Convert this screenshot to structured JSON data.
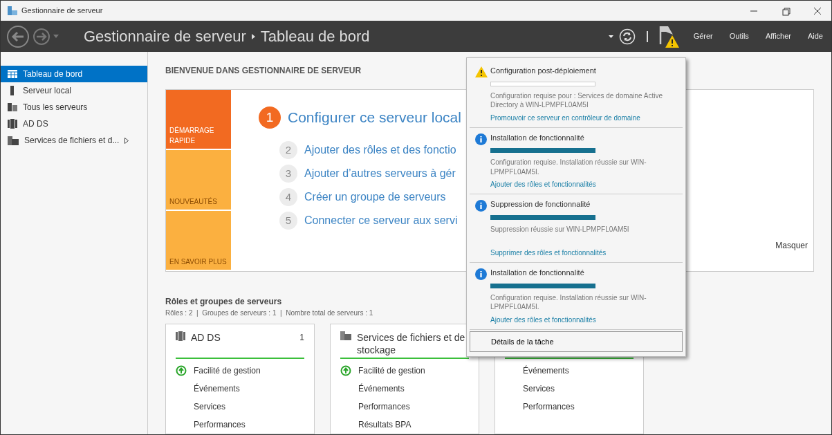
{
  "window": {
    "title": "Gestionnaire de serveur"
  },
  "header": {
    "breadcrumb": [
      "Gestionnaire de serveur",
      "Tableau de bord"
    ],
    "menu": [
      "Gérer",
      "Outils",
      "Afficher",
      "Aide"
    ]
  },
  "sidebar": {
    "items": [
      {
        "label": "Tableau de bord",
        "selected": true,
        "expandable": false
      },
      {
        "label": "Serveur local",
        "selected": false,
        "expandable": false
      },
      {
        "label": "Tous les serveurs",
        "selected": false,
        "expandable": false
      },
      {
        "label": "AD DS",
        "selected": false,
        "expandable": false
      },
      {
        "label": "Services de fichiers et d...",
        "selected": false,
        "expandable": true
      }
    ]
  },
  "welcome": {
    "title": "BIENVENUE DANS GESTIONNAIRE DE SERVEUR",
    "tiles": [
      {
        "label": "DÉMARRAGE RAPIDE",
        "color": "#f26a21"
      },
      {
        "label": "NOUVEAUTÉS",
        "color": "#fbb040"
      },
      {
        "label": "EN SAVOIR PLUS",
        "color": "#fbb040"
      }
    ],
    "steps": [
      {
        "number": "1",
        "label": "Configurer ce serveur local",
        "highlighted": true
      },
      {
        "number": "2",
        "label": "Ajouter des rôles et des fonctio",
        "highlighted": false
      },
      {
        "number": "3",
        "label": "Ajouter d’autres serveurs à gér",
        "highlighted": false
      },
      {
        "number": "4",
        "label": "Créer un groupe de serveurs",
        "highlighted": false
      },
      {
        "number": "5",
        "label": "Connecter ce serveur aux servi",
        "highlighted": false
      }
    ],
    "hide_link": "Masquer"
  },
  "roles": {
    "title": "Rôles et groupes de serveurs",
    "summary": "Rôles : 2  |  Groupes de serveurs : 1  |  Nombre total de serveurs : 1",
    "cards": [
      {
        "title": "AD DS",
        "count": "1",
        "rows": [
          {
            "label": "Facilité de gestion",
            "kind": "health"
          },
          {
            "label": "Événements"
          },
          {
            "label": "Services"
          },
          {
            "label": "Performances"
          }
        ]
      },
      {
        "title": "Services de fichiers et de stockage",
        "rows": [
          {
            "label": "Facilité de gestion",
            "kind": "health"
          },
          {
            "label": "Événements"
          },
          {
            "label": "Performances"
          },
          {
            "label": "Résultats BPA"
          }
        ]
      },
      {
        "rows": [
          {
            "label": "Événements"
          },
          {
            "label": "Services"
          },
          {
            "label": "Performances"
          }
        ]
      }
    ]
  },
  "notifications": {
    "items": [
      {
        "kind": "warning",
        "title": "Configuration post-déploiement",
        "level": 0,
        "message": "Configuration requise pour : Services de domaine Active Directory à WIN-LPMPFL0AM5I",
        "link": "Promouvoir ce serveur en contrôleur de domaine"
      },
      {
        "kind": "info",
        "title": "Installation de fonctionnalité",
        "level": 1,
        "message": "Configuration requise. Installation réussie sur WIN-LPMPFL0AM5I.",
        "link": "Ajouter des rôles et fonctionnalités"
      },
      {
        "kind": "info",
        "title": "Suppression de fonctionnalité",
        "level": 1,
        "message": "Suppression réussie sur WIN-LPMPFL0AM5I",
        "link": "Supprimer des rôles et fonctionnalités"
      },
      {
        "kind": "info",
        "title": "Installation de fonctionnalité",
        "level": 1,
        "message": "Configuration requise. Installation réussie sur WIN-LPMPFL0AM5I.",
        "link": "Ajouter des rôles et fonctionnalités"
      }
    ],
    "details_button": "Détails de la tâche"
  }
}
